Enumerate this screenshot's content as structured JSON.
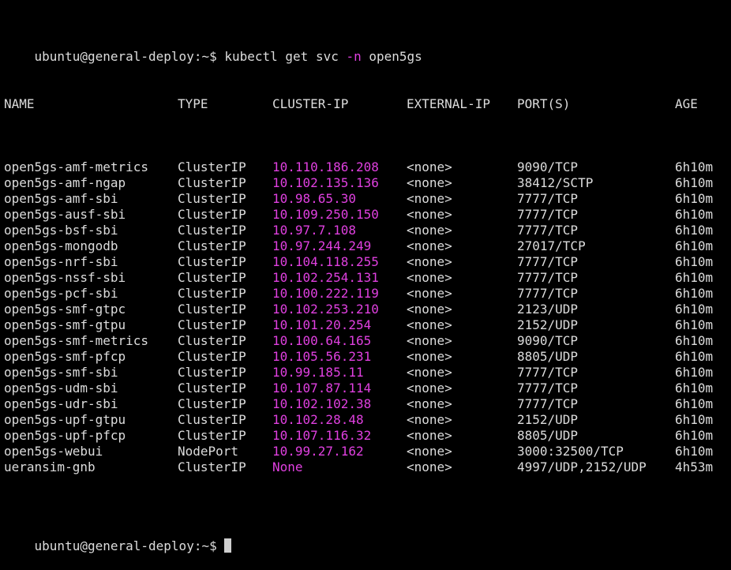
{
  "colors": {
    "background": "#000000",
    "text": "#dcdcdc",
    "ip_highlight": "#e040e0"
  },
  "prompt": {
    "user_host": "ubuntu@general-deploy:~$",
    "command_pre": " kubectl get svc ",
    "flag": "-n",
    "command_post": " open5gs"
  },
  "headers": {
    "name": "NAME",
    "type": "TYPE",
    "cluster_ip": "CLUSTER-IP",
    "external_ip": "EXTERNAL-IP",
    "ports": "PORT(S)",
    "age": "AGE"
  },
  "rows": [
    {
      "name": "open5gs-amf-metrics",
      "type": "ClusterIP",
      "cluster_ip": "10.110.186.208",
      "external_ip": "<none>",
      "ports": "9090/TCP",
      "age": "6h10m"
    },
    {
      "name": "open5gs-amf-ngap",
      "type": "ClusterIP",
      "cluster_ip": "10.102.135.136",
      "external_ip": "<none>",
      "ports": "38412/SCTP",
      "age": "6h10m"
    },
    {
      "name": "open5gs-amf-sbi",
      "type": "ClusterIP",
      "cluster_ip": "10.98.65.30",
      "external_ip": "<none>",
      "ports": "7777/TCP",
      "age": "6h10m"
    },
    {
      "name": "open5gs-ausf-sbi",
      "type": "ClusterIP",
      "cluster_ip": "10.109.250.150",
      "external_ip": "<none>",
      "ports": "7777/TCP",
      "age": "6h10m"
    },
    {
      "name": "open5gs-bsf-sbi",
      "type": "ClusterIP",
      "cluster_ip": "10.97.7.108",
      "external_ip": "<none>",
      "ports": "7777/TCP",
      "age": "6h10m"
    },
    {
      "name": "open5gs-mongodb",
      "type": "ClusterIP",
      "cluster_ip": "10.97.244.249",
      "external_ip": "<none>",
      "ports": "27017/TCP",
      "age": "6h10m"
    },
    {
      "name": "open5gs-nrf-sbi",
      "type": "ClusterIP",
      "cluster_ip": "10.104.118.255",
      "external_ip": "<none>",
      "ports": "7777/TCP",
      "age": "6h10m"
    },
    {
      "name": "open5gs-nssf-sbi",
      "type": "ClusterIP",
      "cluster_ip": "10.102.254.131",
      "external_ip": "<none>",
      "ports": "7777/TCP",
      "age": "6h10m"
    },
    {
      "name": "open5gs-pcf-sbi",
      "type": "ClusterIP",
      "cluster_ip": "10.100.222.119",
      "external_ip": "<none>",
      "ports": "7777/TCP",
      "age": "6h10m"
    },
    {
      "name": "open5gs-smf-gtpc",
      "type": "ClusterIP",
      "cluster_ip": "10.102.253.210",
      "external_ip": "<none>",
      "ports": "2123/UDP",
      "age": "6h10m"
    },
    {
      "name": "open5gs-smf-gtpu",
      "type": "ClusterIP",
      "cluster_ip": "10.101.20.254",
      "external_ip": "<none>",
      "ports": "2152/UDP",
      "age": "6h10m"
    },
    {
      "name": "open5gs-smf-metrics",
      "type": "ClusterIP",
      "cluster_ip": "10.100.64.165",
      "external_ip": "<none>",
      "ports": "9090/TCP",
      "age": "6h10m"
    },
    {
      "name": "open5gs-smf-pfcp",
      "type": "ClusterIP",
      "cluster_ip": "10.105.56.231",
      "external_ip": "<none>",
      "ports": "8805/UDP",
      "age": "6h10m"
    },
    {
      "name": "open5gs-smf-sbi",
      "type": "ClusterIP",
      "cluster_ip": "10.99.185.11",
      "external_ip": "<none>",
      "ports": "7777/TCP",
      "age": "6h10m"
    },
    {
      "name": "open5gs-udm-sbi",
      "type": "ClusterIP",
      "cluster_ip": "10.107.87.114",
      "external_ip": "<none>",
      "ports": "7777/TCP",
      "age": "6h10m"
    },
    {
      "name": "open5gs-udr-sbi",
      "type": "ClusterIP",
      "cluster_ip": "10.102.102.38",
      "external_ip": "<none>",
      "ports": "7777/TCP",
      "age": "6h10m"
    },
    {
      "name": "open5gs-upf-gtpu",
      "type": "ClusterIP",
      "cluster_ip": "10.102.28.48",
      "external_ip": "<none>",
      "ports": "2152/UDP",
      "age": "6h10m"
    },
    {
      "name": "open5gs-upf-pfcp",
      "type": "ClusterIP",
      "cluster_ip": "10.107.116.32",
      "external_ip": "<none>",
      "ports": "8805/UDP",
      "age": "6h10m"
    },
    {
      "name": "open5gs-webui",
      "type": "NodePort",
      "cluster_ip": "10.99.27.162",
      "external_ip": "<none>",
      "ports": "3000:32500/TCP",
      "age": "6h10m"
    },
    {
      "name": "ueransim-gnb",
      "type": "ClusterIP",
      "cluster_ip": "None",
      "external_ip": "<none>",
      "ports": "4997/UDP,2152/UDP",
      "age": "4h53m"
    }
  ],
  "next_prompt": {
    "user_host": "ubuntu@general-deploy:~$"
  }
}
